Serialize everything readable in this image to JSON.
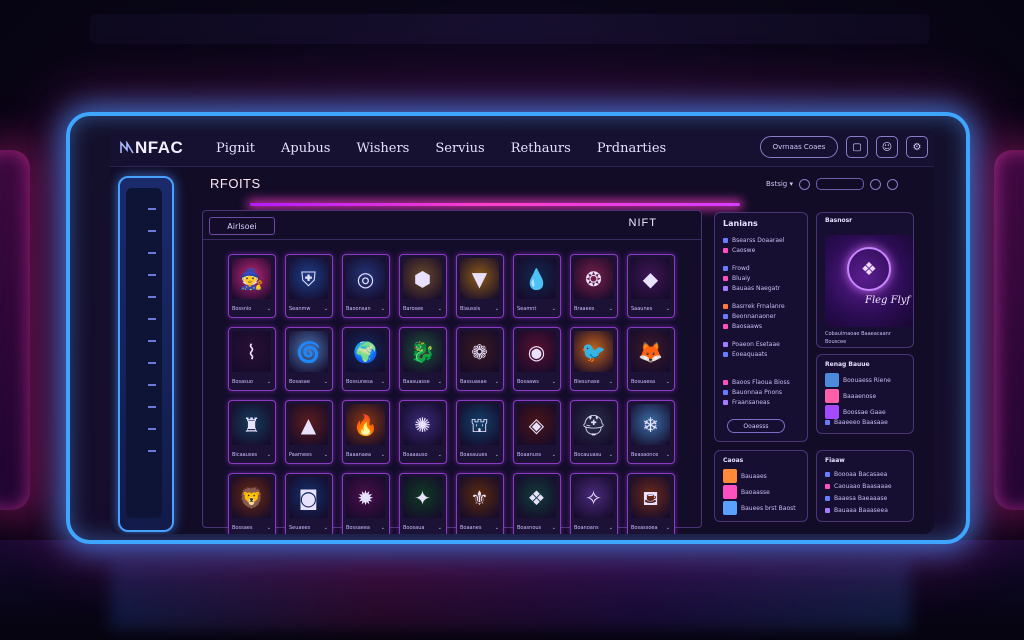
{
  "nav": {
    "logo": "NFAC",
    "menu": [
      "Pignit",
      "Apubus",
      "Wishers",
      "Servius",
      "Rethaurs",
      "Prdnarties"
    ],
    "pill_button": "Ovrnaas Coaes"
  },
  "section": {
    "title": "RFOITS",
    "sort_label": "Bstsig ▾",
    "tab": "Airlsoei",
    "grid_label": "NIFT"
  },
  "cards": [
    {
      "icon": "wizard-icon",
      "glyph": "🧙",
      "bg": "#c2267a",
      "name": "Bossnio"
    },
    {
      "icon": "shield-icon",
      "glyph": "⛨",
      "bg": "#1d3f8a",
      "name": "Seanmw"
    },
    {
      "icon": "globe-icon",
      "glyph": "◎",
      "bg": "#23367a",
      "name": "Baoonsan"
    },
    {
      "icon": "hex-icon",
      "glyph": "⬢",
      "bg": "#6b4a2a",
      "name": "Barosee"
    },
    {
      "icon": "gem-icon",
      "glyph": "▼",
      "bg": "#8a5a18",
      "name": "Biaussis"
    },
    {
      "icon": "water-drop-icon",
      "glyph": "💧",
      "bg": "#13284f",
      "name": "Seamnt"
    },
    {
      "icon": "orb-icon",
      "glyph": "❂",
      "bg": "#792049",
      "name": "Braaees"
    },
    {
      "icon": "crystal-icon",
      "glyph": "◆",
      "bg": "#3e1654",
      "name": "Saaunes"
    },
    {
      "icon": "claws-icon",
      "glyph": "⌇",
      "bg": "#2a1036",
      "name": "Bosasuo"
    },
    {
      "icon": "swirl-icon",
      "glyph": "🌀",
      "bg": "#4a76b4",
      "name": "Bosasae"
    },
    {
      "icon": "planet-icon",
      "glyph": "🌍",
      "bg": "#122a5c",
      "name": "Bossunesa"
    },
    {
      "icon": "dragon-icon",
      "glyph": "🐉",
      "bg": "#1d4f3a",
      "name": "Baasuasse"
    },
    {
      "icon": "ring-icon",
      "glyph": "❁",
      "bg": "#3a1a20",
      "name": "Bassuasae"
    },
    {
      "icon": "eye-icon",
      "glyph": "◉",
      "bg": "#5a1030",
      "name": "Bosaaws"
    },
    {
      "icon": "phoenix-icon",
      "glyph": "🐦",
      "bg": "#c7641a",
      "name": "Biesunase"
    },
    {
      "icon": "fox-icon",
      "glyph": "🦊",
      "bg": "#3d1b2a",
      "name": "Bosuaesa"
    },
    {
      "icon": "totem-icon",
      "glyph": "♜",
      "bg": "#173b5a",
      "name": "Bicaauses"
    },
    {
      "icon": "triangle-icon",
      "glyph": "▲",
      "bg": "#5a1d1d",
      "name": "Paarnees"
    },
    {
      "icon": "flame-icon",
      "glyph": "🔥",
      "bg": "#8a3a10",
      "name": "Baaanaea"
    },
    {
      "icon": "nebula-icon",
      "glyph": "✺",
      "bg": "#3a2a78",
      "name": "Boaaauso"
    },
    {
      "icon": "castle-icon",
      "glyph": "⛫",
      "bg": "#12406a",
      "name": "Boasauues"
    },
    {
      "icon": "diamond-icon",
      "glyph": "◈",
      "bg": "#4a1418",
      "name": "Boaanuss"
    },
    {
      "icon": "helmet-icon",
      "glyph": "⛑",
      "bg": "#2a2f4a",
      "name": "Bocauuasu"
    },
    {
      "icon": "tree-icon",
      "glyph": "❄",
      "bg": "#3a6fa8",
      "name": "Beasaonce"
    },
    {
      "icon": "lion-icon",
      "glyph": "🦁",
      "bg": "#6a2a10",
      "name": "Bossaes"
    },
    {
      "icon": "portal-icon",
      "glyph": "◙",
      "bg": "#14306a",
      "name": "Seuaees"
    },
    {
      "icon": "star-icon",
      "glyph": "✹",
      "bg": "#4a0f4a",
      "name": "Bossaeea"
    },
    {
      "icon": "leaf-icon",
      "glyph": "✦",
      "bg": "#0f3a22",
      "name": "Boosaua"
    },
    {
      "icon": "scroll-icon",
      "glyph": "⚜",
      "bg": "#5a2a0e",
      "name": "Boaanes"
    },
    {
      "icon": "rune-icon",
      "glyph": "❖",
      "bg": "#123a3a",
      "name": "Boasnous"
    },
    {
      "icon": "shard-icon",
      "glyph": "✧",
      "bg": "#4a2a7a",
      "name": "Boanoans"
    },
    {
      "icon": "lantern-icon",
      "glyph": "⛾",
      "bg": "#6a2a1a",
      "name": "Bosassoea"
    }
  ],
  "panel_a": {
    "title": "Lanians",
    "rows": [
      "Bsearss Doaarael",
      "Caoswe",
      "Frowd",
      "Bluaiy",
      "Bauaas Naegatr",
      "Basrrek Frnalanre",
      "Beonnanaoner",
      "Baosaaws",
      "Poaeon Esetaae",
      "Eoeaquaats",
      "Baoos Flaoua Bioss",
      "Bauonnaa Pnons",
      "Fraansaneas"
    ],
    "button": "Ooaesss"
  },
  "panel_b": {
    "title": "Basnosr",
    "featured_title": "Fleg Flyf",
    "caption": "Cobaulmaoae Baaeacaanr",
    "caption2": "Bouscee"
  },
  "panel_c": {
    "title": "Renag Bauue",
    "rows": [
      "Boouaess Riene",
      "Baaaenose",
      "Boossae Gaae",
      "Baaeeeo Baasaae"
    ]
  },
  "panel_d": {
    "title": "Caoas",
    "rows": [
      "Bauaaes",
      "Baoaasse",
      "Bauees brst Baost"
    ]
  },
  "panel_e": {
    "title": "Fiaaw",
    "rows": [
      "Boooaa Bacasaea",
      "Caouaao Baasaaae",
      "Baaesa Baeaaase",
      "Bauaaa Baaaseea"
    ]
  }
}
